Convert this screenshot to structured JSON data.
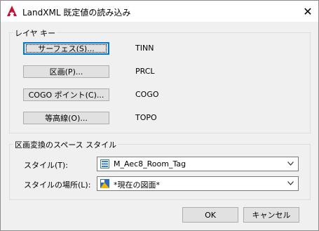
{
  "window": {
    "title": "LandXML 既定値の読み込み",
    "close_glyph": "✕"
  },
  "layer_keys": {
    "group_label": "レイヤ キー",
    "rows": [
      {
        "button": "サーフェス(S)...",
        "value": "TINN"
      },
      {
        "button": "区画(P)...",
        "value": "PRCL"
      },
      {
        "button": "COGO ポイント(C)...",
        "value": "COGO"
      },
      {
        "button": "等高線(O)...",
        "value": "TOPO"
      }
    ]
  },
  "parcel_style": {
    "group_label": "区画変換のスペース スタイル",
    "style_label": "スタイル(T):",
    "style_value": "M_Aec8_Room_Tag",
    "location_label": "スタイルの場所(L):",
    "location_value": "*現在の図面*"
  },
  "footer": {
    "ok": "OK",
    "cancel": "キャンセル"
  },
  "colors": {
    "accent": "#0078d7",
    "autocad_red": "#c8102e"
  }
}
